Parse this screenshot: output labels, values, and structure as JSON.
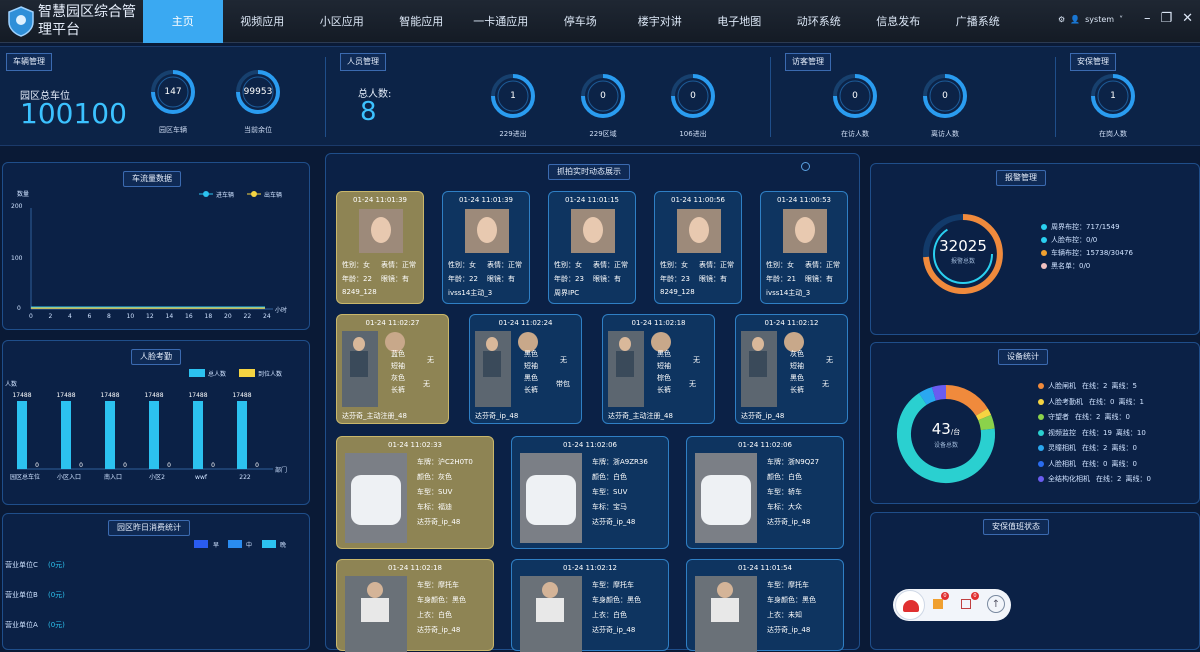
{
  "app": {
    "title": "智慧园区综合管理平台",
    "user": "system"
  },
  "nav": [
    "主页",
    "视频应用",
    "小区应用",
    "智能应用",
    "一卡通应用",
    "停车场",
    "楼宇对讲",
    "电子地图",
    "动环系统",
    "信息发布",
    "广播系统"
  ],
  "top": {
    "vehicle": {
      "tag": "车辆管理",
      "label": "园区总车位",
      "total": "100100",
      "rings": [
        {
          "val": "147",
          "lbl": "园区车辆"
        },
        {
          "val": "99953",
          "lbl": "当前余位"
        }
      ]
    },
    "people": {
      "tag": "人员管理",
      "label": "总人数:",
      "total": "8",
      "rings": [
        {
          "val": "1",
          "lbl": "229进出"
        },
        {
          "val": "0",
          "lbl": "229区域"
        },
        {
          "val": "0",
          "lbl": "106进出"
        }
      ]
    },
    "visitor": {
      "tag": "访客管理",
      "rings": [
        {
          "val": "0",
          "lbl": "在访人数"
        },
        {
          "val": "0",
          "lbl": "离访人数"
        }
      ]
    },
    "security": {
      "tag": "安保管理",
      "rings": [
        {
          "val": "1",
          "lbl": "在岗人数"
        }
      ]
    }
  },
  "traffic": {
    "title": "车流量数据",
    "legend": [
      "进车辆",
      "出车辆"
    ],
    "ylabel": "数量",
    "xlabel": "小时",
    "yticks": [
      "200",
      "100",
      "0"
    ],
    "xticks": [
      "0",
      "2",
      "4",
      "6",
      "8",
      "10",
      "12",
      "14",
      "16",
      "18",
      "20",
      "22",
      "24"
    ]
  },
  "chart_data": {
    "type": "bar",
    "title": "人脸考勤",
    "categories": [
      "园区总车位",
      "小区入口",
      "南入口",
      "小区2",
      "wwf",
      "222"
    ],
    "series": [
      {
        "name": "总人数",
        "values": [
          17488,
          17488,
          17488,
          17488,
          17488,
          17488
        ]
      },
      {
        "name": "到位人数",
        "values": [
          0,
          0,
          0,
          0,
          0,
          0
        ]
      }
    ],
    "ylabel": "人数",
    "xlabel": "部门",
    "colors": [
      "#2cc2f0",
      "#f5d442"
    ]
  },
  "consume": {
    "title": "园区昨日消费统计",
    "legend": [
      "早",
      "中",
      "晚"
    ],
    "rows": [
      {
        "name": "营业单位C",
        "val": "(0元)"
      },
      {
        "name": "营业单位B",
        "val": "(0元)"
      },
      {
        "name": "营业单位A",
        "val": "(0元)"
      }
    ]
  },
  "capture": {
    "title": "抓拍实时动态展示",
    "faces": [
      {
        "time": "01-24 11:01:39",
        "sex": "性别：女",
        "expr": "表情：正常",
        "age": "年龄：22",
        "glasses": "眼镜：有",
        "src": "8249_128",
        "gold": true
      },
      {
        "time": "01-24 11:01:39",
        "sex": "性别：女",
        "expr": "表情：正常",
        "age": "年龄：22",
        "glasses": "眼镜：有",
        "src": "ivss14主动_3",
        "gold": false
      },
      {
        "time": "01-24 11:01:15",
        "sex": "性别：女",
        "expr": "表情：正常",
        "age": "年龄：23",
        "glasses": "眼镜：有",
        "src": "周界IPC",
        "gold": false
      },
      {
        "time": "01-24 11:00:56",
        "sex": "性别：女",
        "expr": "表情：正常",
        "age": "年龄：23",
        "glasses": "眼镜：有",
        "src": "8249_128",
        "gold": false
      },
      {
        "time": "01-24 11:00:53",
        "sex": "性别：女",
        "expr": "表情：正常",
        "age": "年龄：21",
        "glasses": "眼镜：有",
        "src": "ivss14主动_3",
        "gold": false
      }
    ],
    "bodies": [
      {
        "time": "01-24 11:02:27",
        "a": "蓝色",
        "b": "短袖",
        "c": "灰色",
        "d": "长裤",
        "e": "无",
        "f": "无",
        "src": "达芬奇_主动注册_48",
        "gold": true
      },
      {
        "time": "01-24 11:02:24",
        "a": "黑色",
        "b": "短袖",
        "c": "黑色",
        "d": "长裤",
        "e": "无",
        "f": "带包",
        "src": "达芬奇_ip_48",
        "gold": false
      },
      {
        "time": "01-24 11:02:18",
        "a": "黑色",
        "b": "短袖",
        "c": "棕色",
        "d": "长裤",
        "e": "无",
        "f": "无",
        "src": "达芬奇_主动注册_48",
        "gold": false
      },
      {
        "time": "01-24 11:02:12",
        "a": "灰色",
        "b": "短袖",
        "c": "黑色",
        "d": "长裤",
        "e": "无",
        "f": "无",
        "src": "达芬奇_ip_48",
        "gold": false
      }
    ],
    "cars": [
      {
        "time": "01-24 11:02:33",
        "l1": "车牌：沪C2H0T0",
        "l2": "颜色：灰色",
        "l3": "车型：SUV",
        "l4": "车标：福迪",
        "src": "达芬奇_ip_48",
        "gold": true
      },
      {
        "time": "01-24 11:02:06",
        "l1": "车牌：浙A9ZR36",
        "l2": "颜色：白色",
        "l3": "车型：SUV",
        "l4": "车标：宝马",
        "src": "达芬奇_ip_48",
        "gold": false
      },
      {
        "time": "01-24 11:02:06",
        "l1": "车牌：浙N9Q27",
        "l2": "颜色：白色",
        "l3": "车型：轿车",
        "l4": "车标：大众",
        "src": "达芬奇_ip_48",
        "gold": false
      }
    ],
    "bikes": [
      {
        "time": "01-24 11:02:18",
        "l1": "车型：摩托车",
        "l2": "车身颜色：黑色",
        "l3": "上衣：白色",
        "src": "达芬奇_ip_48",
        "gold": true
      },
      {
        "time": "01-24 11:02:12",
        "l1": "车型：摩托车",
        "l2": "车身颜色：黑色",
        "l3": "上衣：白色",
        "src": "达芬奇_ip_48",
        "gold": false
      },
      {
        "time": "01-24 11:01:54",
        "l1": "车型：摩托车",
        "l2": "车身颜色：黑色",
        "l3": "上衣：未知",
        "src": "达芬奇_ip_48",
        "gold": false
      }
    ]
  },
  "alarm": {
    "title": "报警管理",
    "total": "32025",
    "sub": "报警总数",
    "items": [
      "周界布控：717/1549",
      "人脸布控：0/0",
      "车辆布控：15738/30476",
      "黑名单：0/0"
    ],
    "colors": [
      "#2ad0f0",
      "#2ad0f0",
      "#f0a030",
      "#f0c0c0"
    ]
  },
  "device": {
    "title": "设备统计",
    "total": "43",
    "unit": "/台",
    "sub": "设备总数",
    "items": [
      {
        "name": "人脸闸机",
        "online": "在线：2",
        "offline": "离线：5",
        "color": "#f08a3c"
      },
      {
        "name": "人脸考勤机",
        "online": "在线：0",
        "offline": "离线：1",
        "color": "#f5d442"
      },
      {
        "name": "守望者",
        "online": "在线：2",
        "offline": "离线：0",
        "color": "#8bd24b"
      },
      {
        "name": "视频监控",
        "online": "在线：19",
        "offline": "离线：10",
        "color": "#2ad0d0"
      },
      {
        "name": "灵瞳相机",
        "online": "在线：2",
        "offline": "离线：0",
        "color": "#2aa8f0"
      },
      {
        "name": "人脸相机",
        "online": "在线：0",
        "offline": "离线：0",
        "color": "#2a6cf0"
      },
      {
        "name": "全结构化相机",
        "online": "在线：2",
        "offline": "离线：0",
        "color": "#6a5cf0"
      }
    ],
    "values": [
      7,
      1,
      2,
      29,
      2,
      0,
      2
    ]
  },
  "duty": {
    "title": "安保值班状态",
    "badges": [
      "0",
      "0"
    ]
  }
}
